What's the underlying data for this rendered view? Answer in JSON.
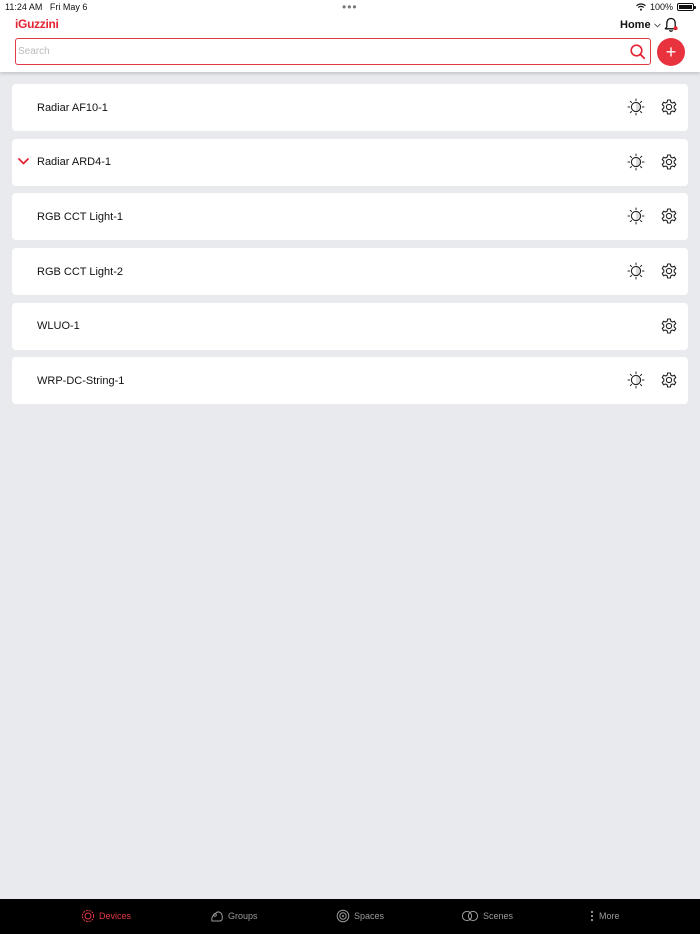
{
  "status": {
    "time": "11:24 AM",
    "date": "Fri May 6",
    "battery": "100%"
  },
  "header": {
    "logo": "iGuzzini",
    "home_label": "Home",
    "search_placeholder": "Search",
    "add_label": "+"
  },
  "devices": [
    {
      "name": "Radiar AF10-1",
      "expanded": false,
      "has_dim": true
    },
    {
      "name": "Radiar ARD4-1",
      "expanded": true,
      "has_dim": true
    },
    {
      "name": "RGB CCT Light-1",
      "expanded": false,
      "has_dim": true
    },
    {
      "name": "RGB CCT Light-2",
      "expanded": false,
      "has_dim": true
    },
    {
      "name": "WLUO-1",
      "expanded": false,
      "has_dim": false
    },
    {
      "name": "WRP-DC-String-1",
      "expanded": false,
      "has_dim": true
    }
  ],
  "tabs": [
    {
      "label": "Devices",
      "icon": "devices-icon",
      "active": true
    },
    {
      "label": "Groups",
      "icon": "groups-icon",
      "active": false
    },
    {
      "label": "Spaces",
      "icon": "spaces-icon",
      "active": false
    },
    {
      "label": "Scenes",
      "icon": "scenes-icon",
      "active": false
    },
    {
      "label": "More",
      "icon": "more-icon",
      "active": false
    }
  ],
  "colors": {
    "accent": "#e42333",
    "background": "#e9eaee",
    "tabbar": "#000000"
  }
}
